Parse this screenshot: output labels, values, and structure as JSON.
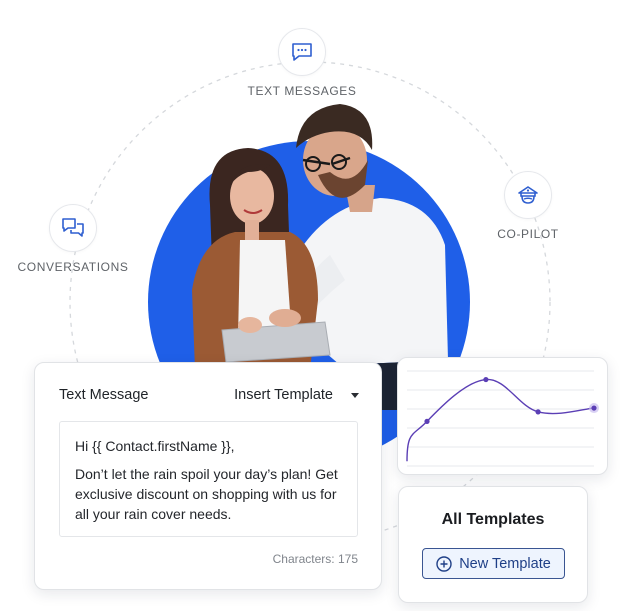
{
  "orbit_nodes": [
    {
      "key": "text-messages",
      "label": "TEXT MESSAGES",
      "icon": "chat-dots-icon"
    },
    {
      "key": "conversations",
      "label": "CONVERSATIONS",
      "icon": "chat-bubbles-icon"
    },
    {
      "key": "co-pilot",
      "label": "CO-PILOT",
      "icon": "pilot-cap-icon"
    }
  ],
  "colors": {
    "accent_blue": "#1f5fe8",
    "icon_blue": "#2f5fd0",
    "chart_line": "#5b3fb5",
    "button_text": "#1f3f87",
    "button_bg": "#eef4fe"
  },
  "text_message_card": {
    "title": "Text Message",
    "insert_template_label": "Insert Template",
    "message_greeting": "Hi {{ Contact.firstName }},",
    "message_body": "Don’t let the rain spoil your day’s plan! Get exclusive discount on shopping with us for all your rain cover needs.",
    "character_count": "Characters: 175"
  },
  "chart_card": {
    "chart_data": {
      "type": "line",
      "x": [
        0,
        1,
        2,
        3,
        4
      ],
      "values": [
        5,
        47,
        91,
        57,
        61
      ],
      "ylim": [
        0,
        100
      ],
      "gridlines": 6,
      "title": "",
      "xlabel": "",
      "ylabel": ""
    }
  },
  "templates_card": {
    "title": "All Templates",
    "new_template_label": "New Template"
  }
}
